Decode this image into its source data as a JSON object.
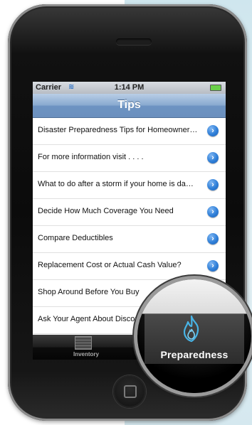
{
  "status_bar": {
    "carrier": "Carrier",
    "time": "1:14 PM"
  },
  "nav": {
    "title": "Tips"
  },
  "tips": [
    {
      "label": "Disaster Preparedness Tips for Homeowners...",
      "has_disclosure": true
    },
    {
      "label": "For more information visit . . . .",
      "has_disclosure": true
    },
    {
      "label": "What to do after a storm if your home is damag...",
      "has_disclosure": true
    },
    {
      "label": "Decide How Much Coverage You Need",
      "has_disclosure": true
    },
    {
      "label": "Compare Deductibles",
      "has_disclosure": true
    },
    {
      "label": "Replacement Cost or Actual Cash Value?",
      "has_disclosure": true
    },
    {
      "label": "Shop Around Before You Buy",
      "has_disclosure": false
    },
    {
      "label": "Ask Your Agent About Discounts",
      "has_disclosure": false
    }
  ],
  "tab_bar": {
    "tabs": [
      {
        "label": "Inventory",
        "icon": "inventory-grid-icon"
      }
    ],
    "selected": {
      "label": "Preparedness",
      "icon": "flame-icon"
    }
  },
  "colors": {
    "nav_accent": "#6b90be",
    "disclosure_blue": "#2f7fd8",
    "flame": "#48b4e6"
  }
}
